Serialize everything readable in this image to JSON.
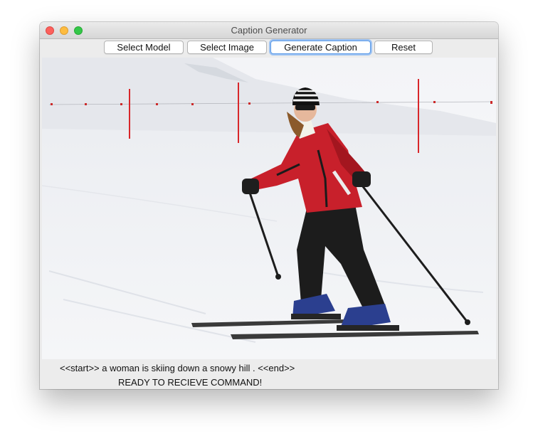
{
  "window": {
    "title": "Caption Generator"
  },
  "toolbar": {
    "select_model_label": "Select Model",
    "select_image_label": "Select Image",
    "generate_caption_label": "Generate Caption",
    "reset_label": "Reset"
  },
  "output": {
    "caption": "<<start>> a woman is skiing down a snowy hill . <<end>>",
    "status": "READY TO RECIEVE COMMAND!"
  },
  "colors": {
    "jacket": "#c8202b",
    "pants": "#1a1a1a",
    "boots": "#2b3f8f",
    "snow": "#f1f2f5",
    "sky": "#f7f8fa",
    "poles_marker": "#d8262a"
  }
}
